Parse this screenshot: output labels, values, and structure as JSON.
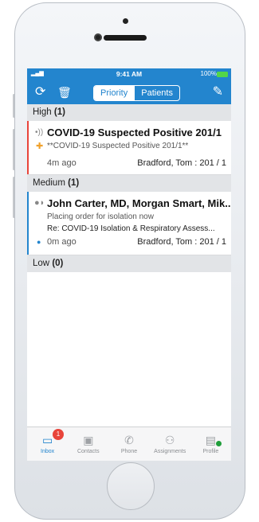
{
  "status": {
    "time": "9:41 AM",
    "battery": "100%"
  },
  "toolbar": {
    "tab_priority": "Priority",
    "tab_patients": "Patients"
  },
  "sections": {
    "high": {
      "label": "High",
      "count": "(1)"
    },
    "medium": {
      "label": "Medium",
      "count": "(1)"
    },
    "low": {
      "label": "Low",
      "count": "(0)"
    }
  },
  "items": [
    {
      "title": "COVID-19 Suspected Positive 201/1",
      "preview": "**COVID-19 Suspected Positive 201/1**",
      "time": "4m ago",
      "patient": "Bradford, Tom : 201 / 1"
    },
    {
      "title": "John Carter, MD, Morgan Smart, Mik...",
      "preview": "Placing order for isolation now",
      "subject": "Re: COVID-19 Isolation & Respiratory Assess...",
      "time": "0m ago",
      "patient": "Bradford, Tom : 201 / 1"
    }
  ],
  "tabs": [
    {
      "label": "Inbox",
      "icon": "inbox-icon",
      "badge": "1"
    },
    {
      "label": "Contacts",
      "icon": "contacts-icon"
    },
    {
      "label": "Phone",
      "icon": "phone-icon"
    },
    {
      "label": "Assignments",
      "icon": "assignments-icon"
    },
    {
      "label": "Profile",
      "icon": "profile-icon"
    }
  ],
  "colors": {
    "accent": "#2385ce",
    "high": "#e8443a",
    "online": "#1f9d3a"
  }
}
